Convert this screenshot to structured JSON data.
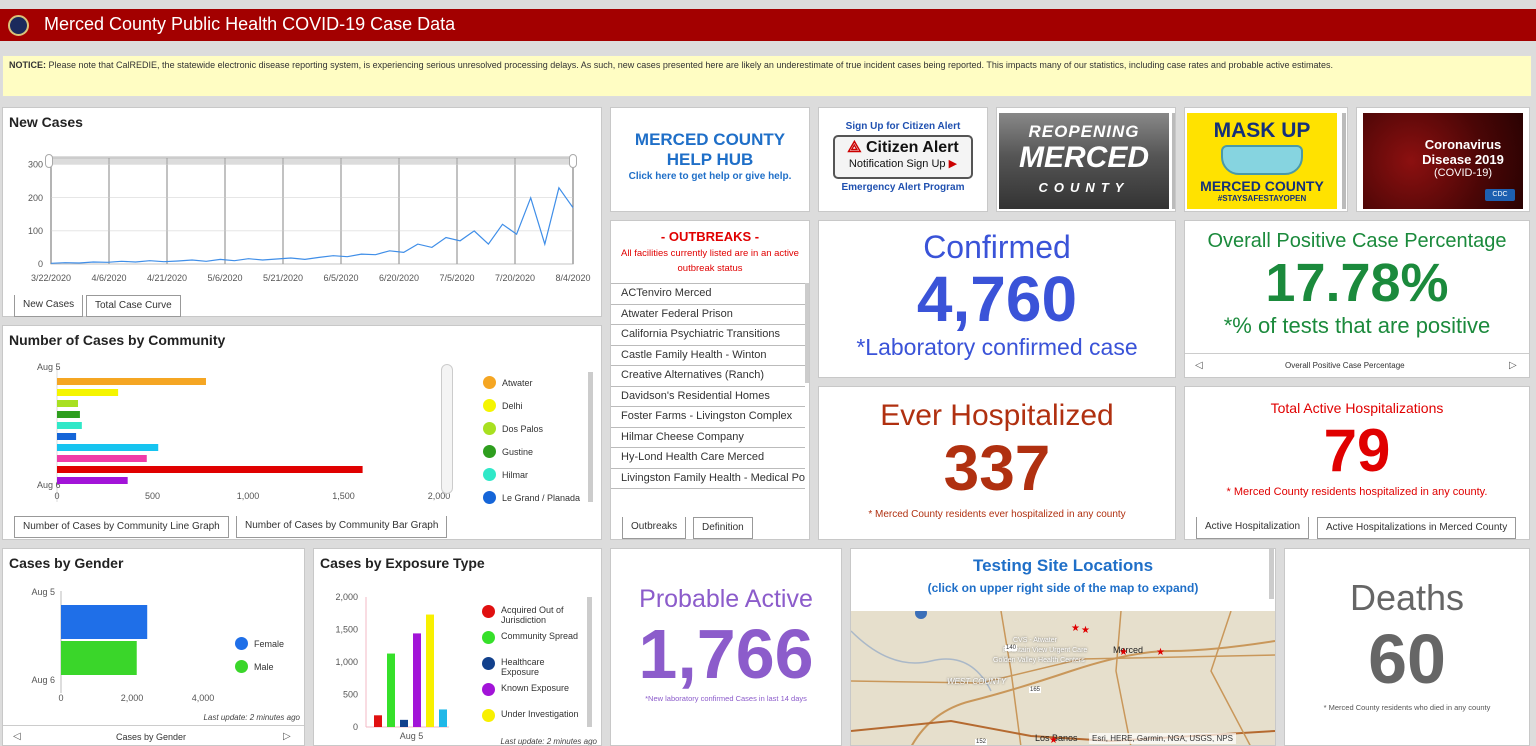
{
  "header": {
    "title": "Merced County Public Health COVID-19 Case Data"
  },
  "notice": {
    "label": "NOTICE:",
    "text": " Please note that CalREDIE, the statewide electronic disease reporting system, is experiencing serious unresolved processing delays. As such, new cases presented here are likely an underestimate of true incident cases being reported. This impacts many of our statistics, including case rates and probable active estimates."
  },
  "new_cases": {
    "title": "New Cases",
    "tabs": [
      "New Cases",
      "Total Case Curve"
    ]
  },
  "community": {
    "title": "Number of Cases by Community",
    "date_top": "Aug 5",
    "date_bottom": "Aug 6",
    "tabs": [
      "Number of Cases by Community Line Graph",
      "Number of Cases by Community Bar Graph"
    ],
    "legend": [
      {
        "name": "Atwater",
        "color": "#f5a623"
      },
      {
        "name": "Delhi",
        "color": "#f5f500"
      },
      {
        "name": "Dos Palos",
        "color": "#a8e020"
      },
      {
        "name": "Gustine",
        "color": "#2e9e1e"
      },
      {
        "name": "Hilmar",
        "color": "#30e8c8"
      },
      {
        "name": "Le Grand / Planada",
        "color": "#1565d8"
      }
    ]
  },
  "gender": {
    "title": "Cases by Gender",
    "date_top": "Aug 5",
    "date_bottom": "Aug 6",
    "footer": "Last update: 2 minutes ago",
    "tab": "Cases by Gender",
    "legend": [
      {
        "name": "Female",
        "color": "#1f6fe8"
      },
      {
        "name": "Male",
        "color": "#3ad62a"
      }
    ]
  },
  "exposure": {
    "title": "Cases by Exposure Type",
    "xlabel": "Aug 5",
    "footer": "Last update: 2 minutes ago",
    "legend": [
      {
        "name": "Acquired Out of Jurisdiction",
        "color": "#e01010"
      },
      {
        "name": "Community Spread",
        "color": "#36e02a"
      },
      {
        "name": "Healthcare Exposure",
        "color": "#12408c"
      },
      {
        "name": "Known Exposure",
        "color": "#a214d8"
      },
      {
        "name": "Under Investigation",
        "color": "#f8f000"
      }
    ]
  },
  "help_hub": {
    "line1": "MERCED COUNTY",
    "line2": "HELP HUB",
    "line3": "Click here to get help or give help."
  },
  "citizen_alert": {
    "top": "Sign Up for Citizen Alert",
    "brand": "Citizen Alert",
    "signup": "Notification Sign Up",
    "bottom": "Emergency Alert Program"
  },
  "reopening": {
    "line1": "REOPENING",
    "line2": "MERCED",
    "line3": "COUNTY"
  },
  "maskup": {
    "line1": "MASK UP",
    "line2": "MERCED COUNTY",
    "line3": "#STAYSAFESTAYOPEN"
  },
  "coronavirus": {
    "line1": "Coronavirus",
    "line2": "Disease 2019",
    "line3": "(COVID-19)",
    "badge": "CDC"
  },
  "outbreaks": {
    "title": "- OUTBREAKS -",
    "subtitle": "All facilities currently listed are in an active outbreak status",
    "items": [
      "ACTenviro Merced",
      "Atwater Federal Prison",
      "California Psychiatric Transitions",
      "Castle Family Health - Winton",
      "Creative Alternatives (Ranch)",
      "Davidson's Residential Homes",
      "Foster Farms - Livingston Complex",
      "Hilmar Cheese Company",
      "Hy-Lond Health Care Merced",
      "Livingston Family Health - Medical Pod"
    ],
    "tabs": [
      "Outbreaks",
      "Definition"
    ]
  },
  "confirmed": {
    "label": "Confirmed",
    "value": "4,760",
    "note": "*Laboratory confirmed case"
  },
  "positive": {
    "label": "Overall Positive Case Percentage",
    "value": "17.78%",
    "note": "*% of tests that are positive",
    "nav": "Overall Positive Case Percentage"
  },
  "hospitalized": {
    "label": "Ever Hospitalized",
    "value": "337",
    "note": "* Merced County residents ever hospitalized in any county"
  },
  "active_hosp": {
    "label": "Total Active Hospitalizations",
    "value": "79",
    "note": "* Merced County residents hospitalized in any county.",
    "tabs": [
      "Active Hospitalization",
      "Active Hospitalizations in Merced County"
    ]
  },
  "probable": {
    "label": "Probable Active",
    "value": "1,766",
    "note": "*New laboratory confirmed Cases in last 14 days"
  },
  "testing": {
    "title": "Testing Site Locations",
    "subtitle": "(click on upper right side of the map to expand)",
    "map_labels": [
      "CVS - Atwater",
      "Fountain View Urgent Care",
      "Golden Valley Health Centers",
      "Merced",
      "WEST COUNTY",
      "Los Banos",
      "140",
      "165",
      "152"
    ],
    "attribution": "Esri, HERE, Garmin, NGA, USGS, NPS"
  },
  "deaths": {
    "label": "Deaths",
    "value": "60",
    "note": "* Merced County residents who died in any county"
  },
  "chart_data": [
    {
      "type": "line",
      "title": "New Cases",
      "x": [
        "3/22/2020",
        "3/26/2020",
        "3/30/2020",
        "4/3/2020",
        "4/6/2020",
        "4/10/2020",
        "4/14/2020",
        "4/18/2020",
        "4/21/2020",
        "4/25/2020",
        "4/29/2020",
        "5/2/2020",
        "5/6/2020",
        "5/10/2020",
        "5/14/2020",
        "5/18/2020",
        "5/21/2020",
        "5/25/2020",
        "5/29/2020",
        "6/2/2020",
        "6/5/2020",
        "6/9/2020",
        "6/13/2020",
        "6/17/2020",
        "6/20/2020",
        "6/24/2020",
        "6/28/2020",
        "7/1/2020",
        "7/5/2020",
        "7/9/2020",
        "7/13/2020",
        "7/17/2020",
        "7/20/2020",
        "7/23/2020",
        "7/26/2020",
        "7/29/2020",
        "8/1/2020",
        "8/4/2020"
      ],
      "values": [
        2,
        4,
        3,
        6,
        5,
        8,
        6,
        10,
        7,
        9,
        12,
        8,
        14,
        10,
        16,
        12,
        15,
        18,
        14,
        20,
        25,
        22,
        30,
        28,
        40,
        35,
        60,
        50,
        80,
        70,
        100,
        60,
        120,
        90,
        200,
        60,
        230,
        170
      ],
      "xticks": [
        "3/22/2020",
        "4/6/2020",
        "4/21/2020",
        "5/6/2020",
        "5/21/2020",
        "6/5/2020",
        "6/20/2020",
        "7/5/2020",
        "7/20/2020",
        "8/4/2020"
      ],
      "yticks": [
        0,
        100,
        200,
        300
      ],
      "ylim": [
        0,
        320
      ]
    },
    {
      "type": "bar",
      "title": "Number of Cases by Community",
      "orientation": "horizontal",
      "values": [
        780,
        320,
        110,
        120,
        130,
        100,
        530,
        470,
        1600,
        370
      ],
      "xticks": [
        "0",
        "500",
        "1,000",
        "1,500",
        "2,000"
      ],
      "xlim": [
        0,
        2000
      ]
    },
    {
      "type": "bar",
      "title": "Cases by Gender",
      "orientation": "horizontal",
      "series": [
        {
          "name": "Female",
          "values": [
            2550
          ]
        },
        {
          "name": "Male",
          "values": [
            2240
          ]
        }
      ],
      "xticks": [
        "0",
        "2,000",
        "4,000"
      ],
      "xlim": [
        0,
        4200
      ]
    },
    {
      "type": "bar",
      "title": "Cases by Exposure Type",
      "categories": [
        "Aug 5"
      ],
      "series": [
        {
          "name": "Acquired Out of Jurisdiction",
          "values": [
            180
          ]
        },
        {
          "name": "Community Spread",
          "values": [
            1130
          ]
        },
        {
          "name": "Healthcare Exposure",
          "values": [
            110
          ]
        },
        {
          "name": "Known Exposure",
          "values": [
            1440
          ]
        },
        {
          "name": "Under Investigation",
          "values": [
            1730
          ]
        },
        {
          "name": "",
          "values": [
            270
          ]
        }
      ],
      "yticks": [
        "0",
        "500",
        "1,000",
        "1,500",
        "2,000"
      ],
      "ylim": [
        0,
        2000
      ]
    }
  ]
}
